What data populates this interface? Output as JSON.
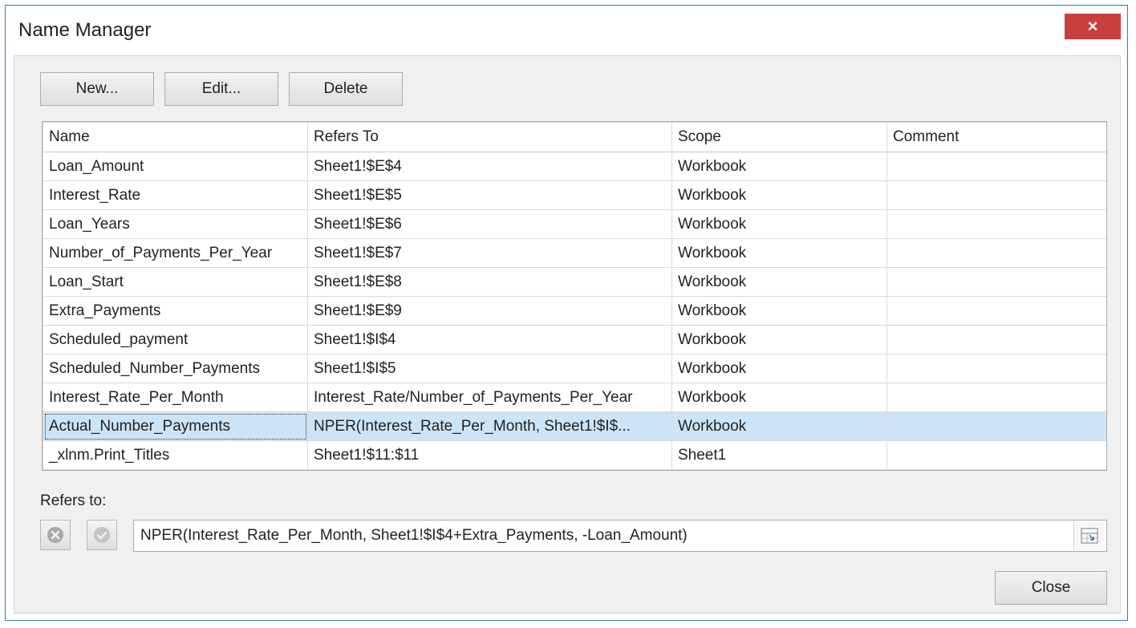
{
  "window": {
    "title": "Name Manager",
    "close_glyph": "×"
  },
  "toolbar": {
    "new_label": "New...",
    "edit_label": "Edit...",
    "delete_label": "Delete"
  },
  "columns": [
    "Name",
    "Refers To",
    "Scope",
    "Comment"
  ],
  "rows": [
    {
      "name": "Loan_Amount",
      "refers": "Sheet1!$E$4",
      "scope": "Workbook",
      "comment": ""
    },
    {
      "name": "Interest_Rate",
      "refers": "Sheet1!$E$5",
      "scope": "Workbook",
      "comment": ""
    },
    {
      "name": "Loan_Years",
      "refers": "Sheet1!$E$6",
      "scope": "Workbook",
      "comment": ""
    },
    {
      "name": "Number_of_Payments_Per_Year",
      "refers": "Sheet1!$E$7",
      "scope": "Workbook",
      "comment": ""
    },
    {
      "name": "Loan_Start",
      "refers": "Sheet1!$E$8",
      "scope": "Workbook",
      "comment": ""
    },
    {
      "name": "Extra_Payments",
      "refers": "Sheet1!$E$9",
      "scope": "Workbook",
      "comment": ""
    },
    {
      "name": "Scheduled_payment",
      "refers": "Sheet1!$I$4",
      "scope": "Workbook",
      "comment": ""
    },
    {
      "name": "Scheduled_Number_Payments",
      "refers": "Sheet1!$I$5",
      "scope": "Workbook",
      "comment": ""
    },
    {
      "name": "Interest_Rate_Per_Month",
      "refers": "Interest_Rate/Number_of_Payments_Per_Year",
      "scope": "Workbook",
      "comment": ""
    },
    {
      "name": "Actual_Number_Payments",
      "refers": "NPER(Interest_Rate_Per_Month, Sheet1!$I$...",
      "scope": "Workbook",
      "comment": "",
      "selected": true
    },
    {
      "name": "_xlnm.Print_Titles",
      "refers": "Sheet1!$11:$11",
      "scope": "Sheet1",
      "comment": ""
    }
  ],
  "refers_to": {
    "label": "Refers to:",
    "value": "NPER(Interest_Rate_Per_Month, Sheet1!$I$4+Extra_Payments, -Loan_Amount)",
    "cancel_icon": "cancel-icon",
    "confirm_icon": "check-icon",
    "collapse_icon": "collapse-dialog-icon"
  },
  "footer": {
    "close_label": "Close"
  },
  "colors": {
    "accent": "#2b78c5",
    "close_red": "#c8403d",
    "selection": "#cce4f7",
    "dialog_bg": "#f0f0f0"
  }
}
